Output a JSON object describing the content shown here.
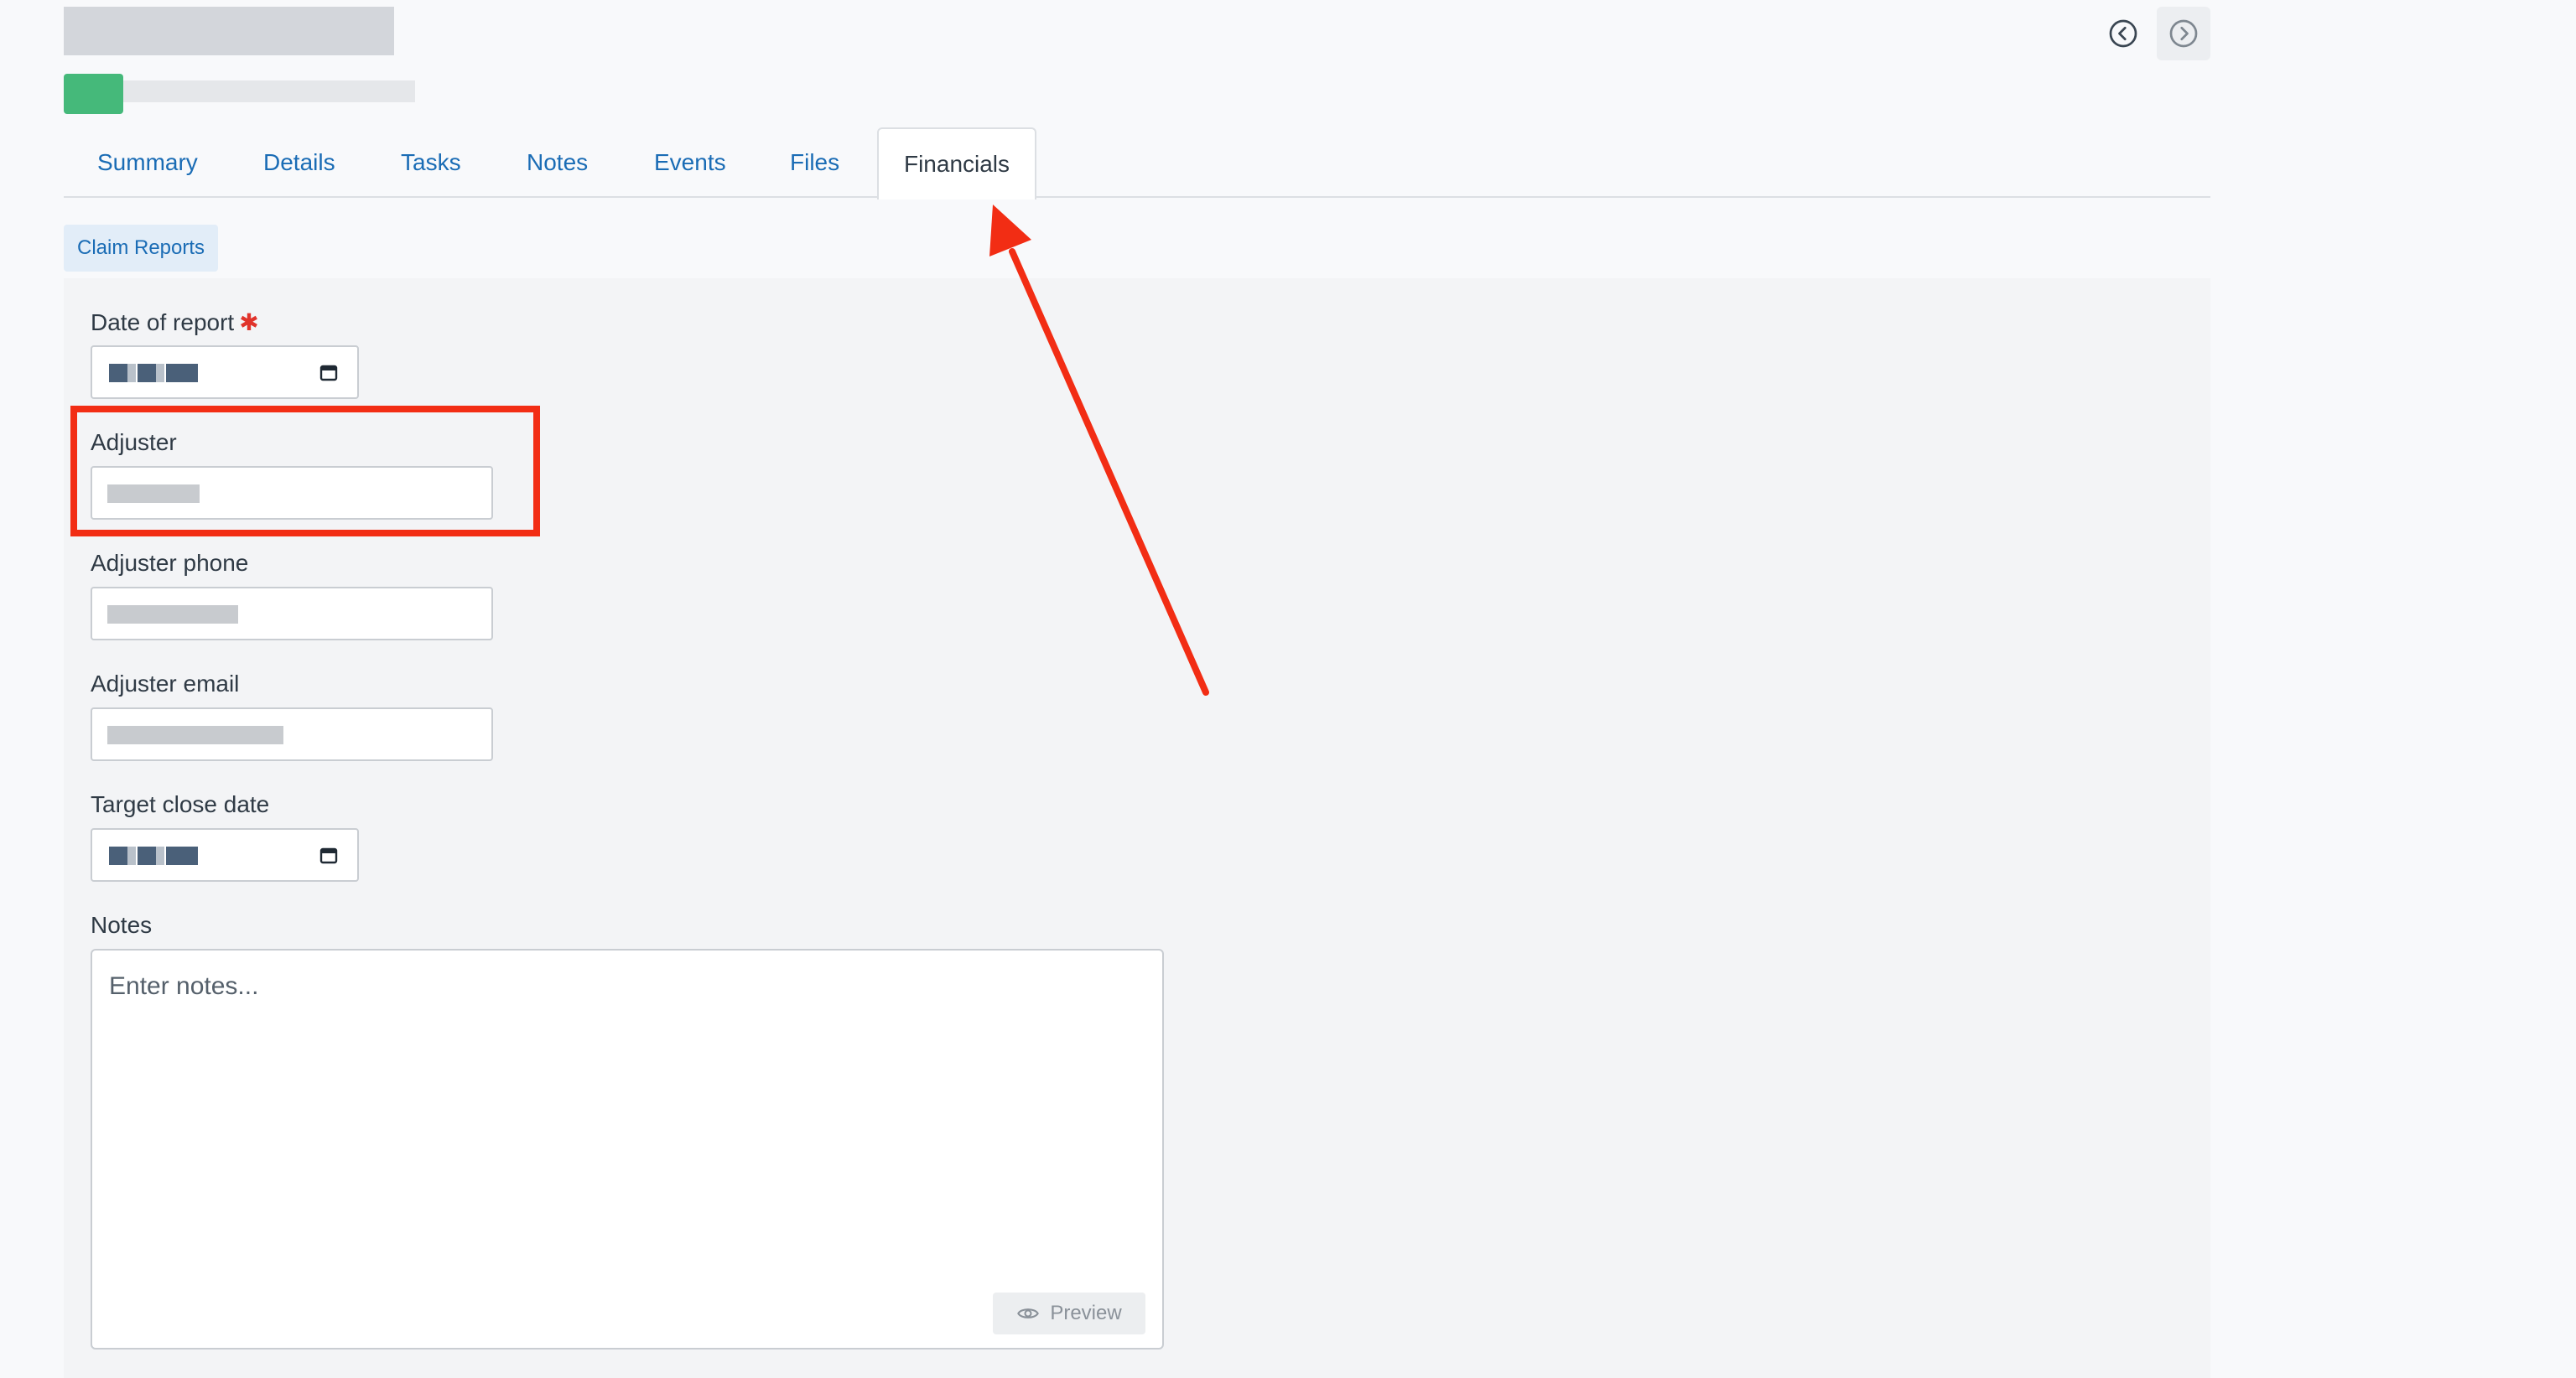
{
  "tabs": [
    {
      "label": "Summary"
    },
    {
      "label": "Details"
    },
    {
      "label": "Tasks"
    },
    {
      "label": "Notes"
    },
    {
      "label": "Events"
    },
    {
      "label": "Files"
    },
    {
      "label": "Financials"
    }
  ],
  "active_tab": "Financials",
  "subtab": {
    "label": "Claim Reports"
  },
  "form": {
    "date_of_report": {
      "label": "Date of report",
      "required_mark": "✱"
    },
    "adjuster": {
      "label": "Adjuster"
    },
    "adjuster_phone": {
      "label": "Adjuster phone"
    },
    "adjuster_email": {
      "label": "Adjuster email"
    },
    "target_close_date": {
      "label": "Target close date"
    },
    "notes": {
      "label": "Notes",
      "placeholder": "Enter notes..."
    }
  },
  "preview_button": {
    "label": "Preview"
  },
  "colors": {
    "accent": "#1a6cb5",
    "status_green": "#45b97a",
    "annotation_red": "#f22d14",
    "required_red": "#e0332b"
  },
  "icons": {
    "nav_prev": "chevron-left-circle-icon",
    "nav_next": "chevron-right-circle-icon",
    "calendar": "calendar-icon",
    "preview": "eye-icon"
  }
}
